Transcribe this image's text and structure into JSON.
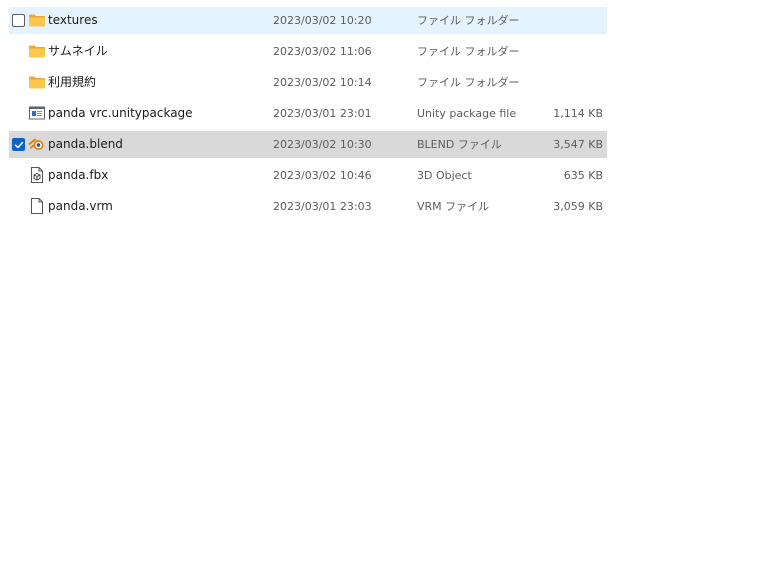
{
  "files": [
    {
      "name": "textures",
      "date": "2023/03/02 10:20",
      "type": "ファイル フォルダー",
      "size": "",
      "icon": "folder-icon",
      "checked": false,
      "state": "hover"
    },
    {
      "name": "サムネイル",
      "date": "2023/03/02 11:06",
      "type": "ファイル フォルダー",
      "size": "",
      "icon": "folder-icon",
      "checked": false,
      "state": ""
    },
    {
      "name": "利用規約",
      "date": "2023/03/02 10:14",
      "type": "ファイル フォルダー",
      "size": "",
      "icon": "folder-icon",
      "checked": false,
      "state": ""
    },
    {
      "name": "panda vrc.unitypackage",
      "date": "2023/03/01 23:01",
      "type": "Unity package file",
      "size": "1,114 KB",
      "icon": "unity-package-icon",
      "checked": false,
      "state": ""
    },
    {
      "name": "panda.blend",
      "date": "2023/03/02 10:30",
      "type": "BLEND ファイル",
      "size": "3,547 KB",
      "icon": "blender-icon",
      "checked": true,
      "state": "selected"
    },
    {
      "name": "panda.fbx",
      "date": "2023/03/02 10:46",
      "type": "3D Object",
      "size": "635 KB",
      "icon": "3d-object-icon",
      "checked": false,
      "state": ""
    },
    {
      "name": "panda.vrm",
      "date": "2023/03/01 23:03",
      "type": "VRM ファイル",
      "size": "3,059 KB",
      "icon": "file-icon",
      "checked": false,
      "state": ""
    }
  ],
  "colors": {
    "hover": "#e5f3ff",
    "selected": "#d9d9d9",
    "checkbox_accent": "#0a63c9",
    "folder": "#f8c74c"
  }
}
